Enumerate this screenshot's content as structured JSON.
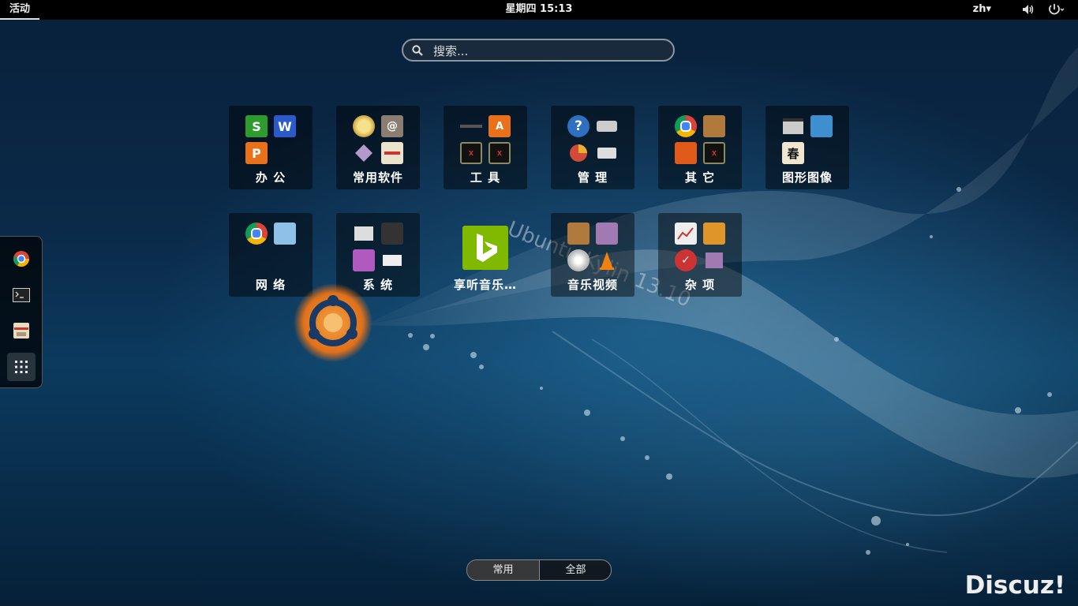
{
  "topbar": {
    "activities": "活动",
    "clock": "星期四 15:13",
    "language": "zh▾"
  },
  "search": {
    "placeholder": "搜索..."
  },
  "folders": [
    {
      "label": "办 公"
    },
    {
      "label": "常用软件"
    },
    {
      "label": "工 具"
    },
    {
      "label": "管 理"
    },
    {
      "label": "其 它"
    },
    {
      "label": "图形图像"
    },
    {
      "label": "网 络"
    },
    {
      "label": "系 统"
    },
    {
      "label": "享听音乐…"
    },
    {
      "label": "音乐视频"
    },
    {
      "label": "杂 项"
    }
  ],
  "office_icons": {
    "s": "S",
    "w": "W",
    "p": "P"
  },
  "misc_text": {
    "spring": "春"
  },
  "wallpaper_text": "Ubuntu Kylin 13.10",
  "dash": {
    "items": [
      {
        "icon": "chrome-icon"
      },
      {
        "icon": "terminal-icon"
      },
      {
        "icon": "file-cabinet-icon"
      },
      {
        "icon": "show-apps-icon"
      }
    ]
  },
  "pager": {
    "frequent": "常用",
    "all": "全部"
  },
  "watermark": "Discuz!",
  "colors": {
    "topbar": "#000000",
    "accent_orange": "#e8711a",
    "bing_green": "#7fba00"
  }
}
